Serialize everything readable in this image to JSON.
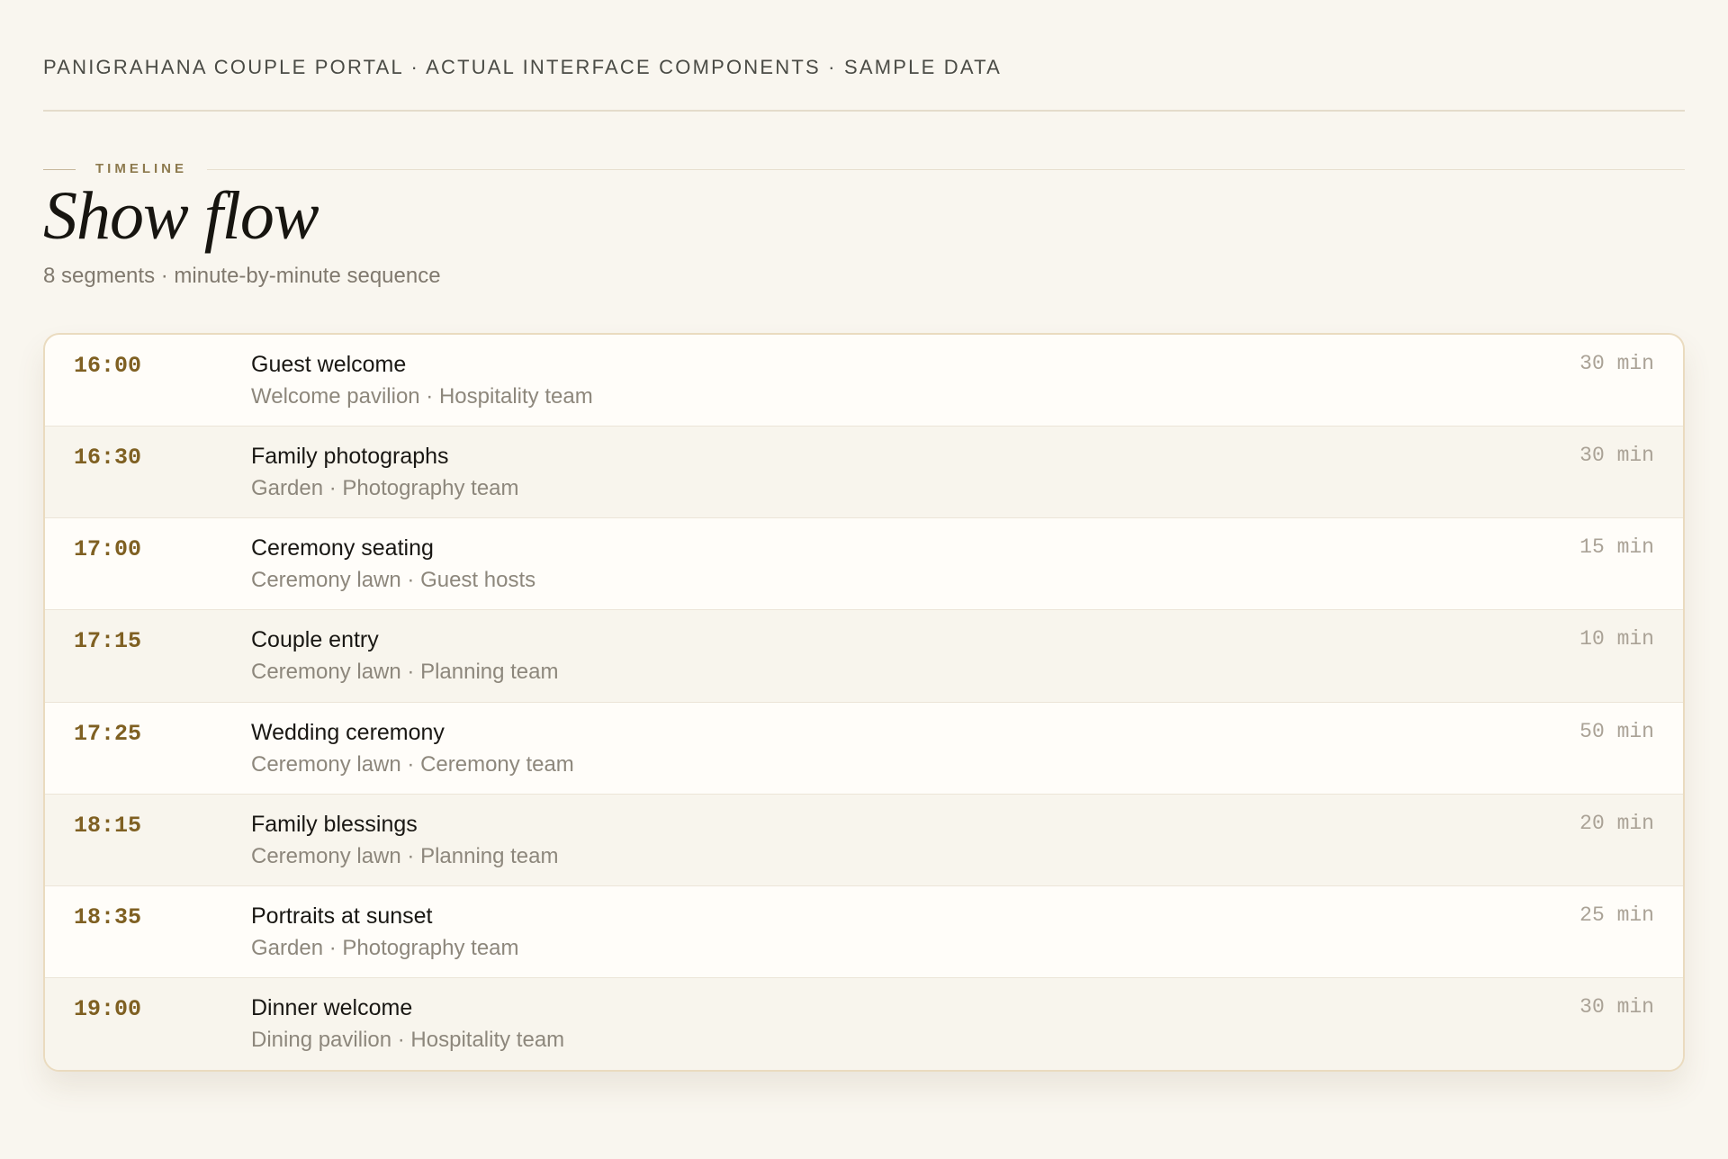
{
  "header": {
    "top_label": "PANIGRAHANA COUPLE PORTAL · ACTUAL INTERFACE COMPONENTS · SAMPLE DATA"
  },
  "section": {
    "eyebrow": "TIMELINE",
    "title": "Show flow",
    "subtitle": "8 segments · minute-by-minute sequence"
  },
  "timeline": {
    "segments": [
      {
        "time": "16:00",
        "title": "Guest welcome",
        "meta": "Welcome pavilion · Hospitality team",
        "duration": "30 min"
      },
      {
        "time": "16:30",
        "title": "Family photographs",
        "meta": "Garden · Photography team",
        "duration": "30 min"
      },
      {
        "time": "17:00",
        "title": "Ceremony seating",
        "meta": "Ceremony lawn · Guest hosts",
        "duration": "15 min"
      },
      {
        "time": "17:15",
        "title": "Couple entry",
        "meta": "Ceremony lawn · Planning team",
        "duration": "10 min"
      },
      {
        "time": "17:25",
        "title": "Wedding ceremony",
        "meta": "Ceremony lawn · Ceremony team",
        "duration": "50 min"
      },
      {
        "time": "18:15",
        "title": "Family blessings",
        "meta": "Ceremony lawn · Planning team",
        "duration": "20 min"
      },
      {
        "time": "18:35",
        "title": "Portraits at sunset",
        "meta": "Garden · Photography team",
        "duration": "25 min"
      },
      {
        "time": "19:00",
        "title": "Dinner welcome",
        "meta": "Dining pavilion · Hospitality team",
        "duration": "30 min"
      }
    ]
  }
}
